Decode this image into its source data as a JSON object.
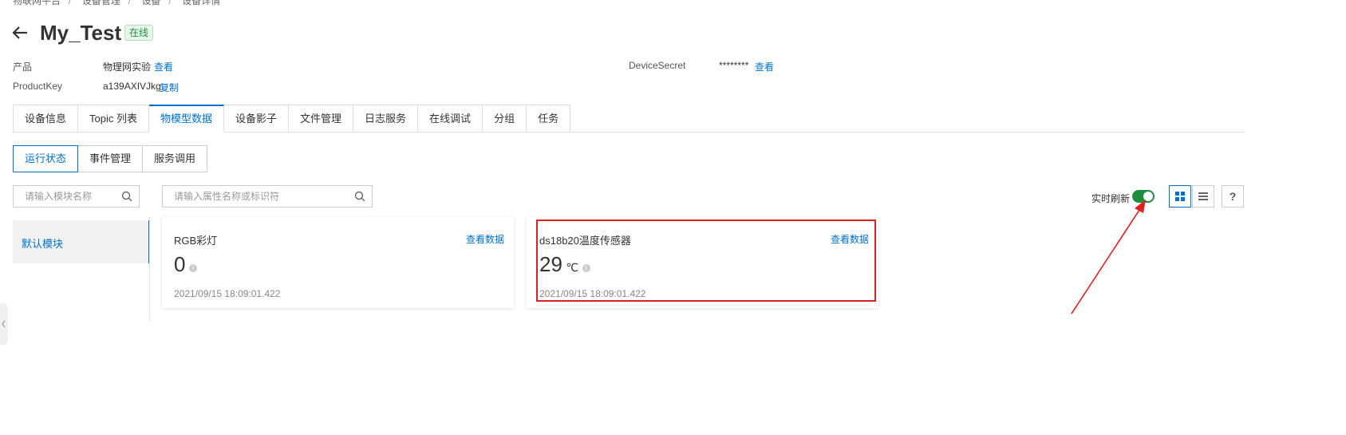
{
  "breadcrumb": [
    "物联网平台",
    "设备管理",
    "设备",
    "设备详情"
  ],
  "device": {
    "name": "My_Test",
    "status": "在线"
  },
  "meta": {
    "product_label": "产品",
    "product_value": "物理网实验",
    "product_link": "查看",
    "productkey_label": "ProductKey",
    "productkey_value": "a139AXIVJkg",
    "productkey_link": "复制",
    "secret_label": "DeviceSecret",
    "secret_value": "********",
    "secret_link": "查看"
  },
  "tabs": [
    "设备信息",
    "Topic 列表",
    "物模型数据",
    "设备影子",
    "文件管理",
    "日志服务",
    "在线调试",
    "分组",
    "任务"
  ],
  "active_tab": "物模型数据",
  "subtabs": [
    "运行状态",
    "事件管理",
    "服务调用"
  ],
  "module_search": {
    "placeholder": "请输入模块名称"
  },
  "property_search": {
    "placeholder": "请输入属性名称或标识符"
  },
  "module": {
    "label": "默认模块"
  },
  "cards": [
    {
      "title": "RGB彩灯",
      "link": "查看数据",
      "value": "0",
      "unit": "",
      "time": "2021/09/15 18:09:01.422"
    },
    {
      "title": "ds18b20温度传感器",
      "link": "查看数据",
      "value": "29",
      "unit": "℃",
      "time": "2021/09/15 18:09:01.422"
    }
  ],
  "realtime": {
    "label": "实时刷新",
    "enabled": true
  },
  "colors": {
    "accent": "#0070cc",
    "online": "#1e8e3e",
    "highlight": "#e02020"
  },
  "icons": [
    "back-arrow-icon",
    "search-icon",
    "grid-view-icon",
    "list-view-icon",
    "help-icon",
    "info-icon",
    "chevron-left-icon"
  ]
}
